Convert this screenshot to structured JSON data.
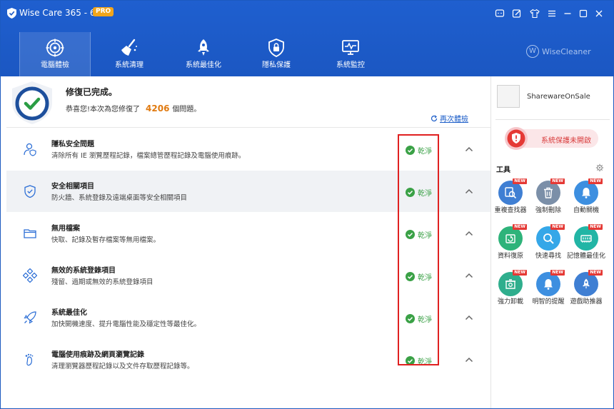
{
  "app": {
    "title": "Wise Care 365 - 6.3.2",
    "badge": "PRO"
  },
  "tabs": [
    {
      "label": "電腦體檢"
    },
    {
      "label": "系統清理"
    },
    {
      "label": "系統最佳化"
    },
    {
      "label": "隱私保護"
    },
    {
      "label": "系統監控"
    }
  ],
  "brand": "WiseCleaner",
  "summary": {
    "title": "修復已完成。",
    "subtitle_prefix": "恭喜您!本次為您修復了",
    "count": "4206",
    "subtitle_suffix": "個問題。",
    "rescan_label": "再次體檢"
  },
  "rows": [
    {
      "title": "隱私安全問題",
      "desc": "清除所有 IE 瀏覽歷程記錄，檔案總管歷程記錄及電腦使用痕跡。",
      "status": "乾淨"
    },
    {
      "title": "安全相關項目",
      "desc": "防火牆、系統登錄及遠端桌面等安全相關項目",
      "status": "乾淨"
    },
    {
      "title": "無用檔案",
      "desc": "快取、記錄及暫存檔案等無用檔案。",
      "status": "乾淨"
    },
    {
      "title": "無效的系統登錄項目",
      "desc": "殘留、過期或無效的系統登錄項目",
      "status": "乾淨"
    },
    {
      "title": "系統最佳化",
      "desc": "加快開機速度、提升電腦性能及穩定性等最佳化。",
      "status": "乾淨"
    },
    {
      "title": "電腦使用痕跡及網頁瀏覽記錄",
      "desc": "清理瀏覽器歷程記錄以及文件存取歷程記錄等。",
      "status": "乾淨"
    }
  ],
  "sidebar": {
    "username": "SharewareOnSale",
    "protection_label": "系統保護未開啟",
    "tools_title": "工具",
    "tools": [
      {
        "label": "重複查找器",
        "badge": "NEW"
      },
      {
        "label": "強制刪除",
        "badge": "NEW"
      },
      {
        "label": "自動關機",
        "badge": "NEW"
      },
      {
        "label": "資料復原",
        "badge": "NEW"
      },
      {
        "label": "快速尋找",
        "badge": "NEW"
      },
      {
        "label": "記憶體最佳化",
        "badge": "NEW"
      },
      {
        "label": "強力卸載",
        "badge": "NEW"
      },
      {
        "label": "明智的提醒",
        "badge": "NEW"
      },
      {
        "label": "遊戲助推器",
        "badge": "NEW"
      }
    ]
  },
  "colors": {
    "header": "#1d5bc7",
    "accent": "#1a5cc8",
    "clean": "#3aa146",
    "alert": "#d83a3a",
    "count": "#e07a10"
  }
}
